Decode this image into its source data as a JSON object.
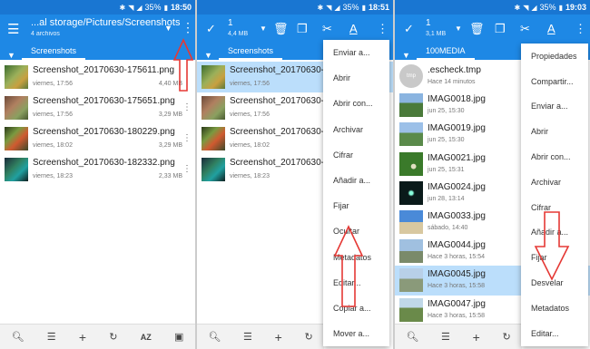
{
  "p1": {
    "status": {
      "battery": "35%",
      "time": "18:50"
    },
    "title": "...al storage/Pictures/Screenshots",
    "subtitle": "4 archivos",
    "tab": "Screenshots",
    "files": [
      {
        "name": "Screenshot_20170630-175611.png",
        "date": "viernes, 17:56",
        "size": "4,40 MB"
      },
      {
        "name": "Screenshot_20170630-175651.png",
        "date": "viernes, 17:56",
        "size": "3,29 MB"
      },
      {
        "name": "Screenshot_20170630-180229.png",
        "date": "viernes, 18:02",
        "size": "3,29 MB"
      },
      {
        "name": "Screenshot_20170630-182332.png",
        "date": "viernes, 18:23",
        "size": "2,33 MB"
      }
    ],
    "bottom": {
      "sort": "AZ"
    }
  },
  "p2": {
    "status": {
      "battery": "35%",
      "time": "18:51"
    },
    "sel_count": "1",
    "sel_size": "4,4 MB",
    "tab": "Screenshots",
    "files": [
      {
        "name": "Screenshot_20170630-17",
        "date": "viernes, 17:56"
      },
      {
        "name": "Screenshot_20170630-17",
        "date": "viernes, 17:56"
      },
      {
        "name": "Screenshot_20170630-18",
        "date": "viernes, 18:02"
      },
      {
        "name": "Screenshot_20170630-18",
        "date": "viernes, 18:23"
      }
    ],
    "menu": [
      "Enviar a...",
      "Abrir",
      "Abrir con...",
      "Archivar",
      "Cifrar",
      "Añadir a...",
      "Fijar",
      "Ocultar",
      "Metadatos",
      "Editar...",
      "Copiar a...",
      "Mover a..."
    ]
  },
  "p3": {
    "status": {
      "battery": "35%",
      "time": "19:03"
    },
    "sel_count": "1",
    "sel_size": "3,1 MB",
    "tab": "100MEDIA",
    "files": [
      {
        "name": ".escheck.tmp",
        "date": "Hace 14 minutos",
        "thumb": "tmp"
      },
      {
        "name": "IMAG0018.jpg",
        "date": "jun 25, 15:30"
      },
      {
        "name": "IMAG0019.jpg",
        "date": "jun 25, 15:30"
      },
      {
        "name": "IMAG0021.jpg",
        "date": "jun 25, 15:31"
      },
      {
        "name": "IMAG0024.jpg",
        "date": "jun 28, 13:14"
      },
      {
        "name": "IMAG0033.jpg",
        "date": "sábado, 14:40"
      },
      {
        "name": "IMAG0044.jpg",
        "date": "Hace 3 horas, 15:54"
      },
      {
        "name": "IMAG0045.jpg",
        "date": "Hace 3 horas, 15:58"
      },
      {
        "name": "IMAG0047.jpg",
        "date": "Hace 3 horas, 15:58"
      }
    ],
    "tmp_label": "tmp",
    "menu": [
      "Propiedades",
      "Compartir...",
      "Enviar a...",
      "Abrir",
      "Abrir con...",
      "Archivar",
      "Cifrar",
      "Añadir a...",
      "Fijar",
      "Desvelar",
      "Metadatos",
      "Editar..."
    ]
  },
  "colors": {
    "primary": "#1E88E5",
    "status": "#1976D2",
    "selected": "#BBDEFB",
    "arrow": "#E53935"
  }
}
